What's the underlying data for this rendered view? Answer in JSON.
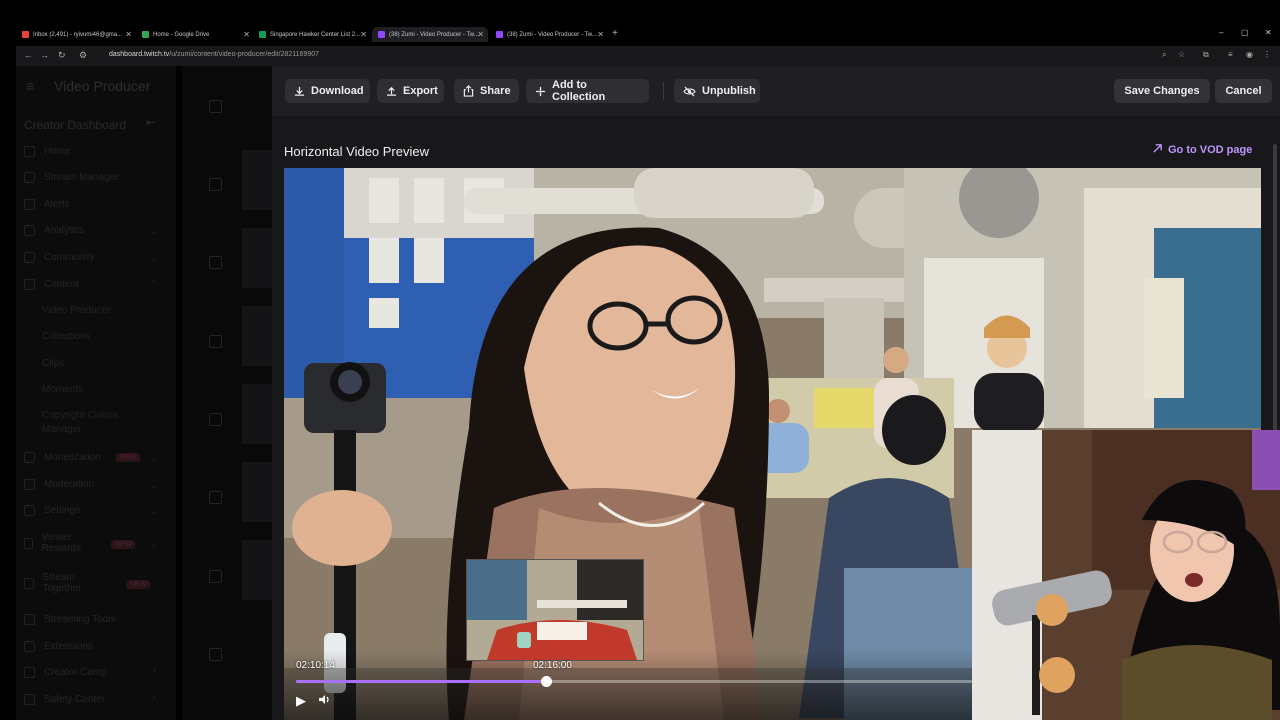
{
  "browser": {
    "tabs": [
      {
        "title": "Inbox (2,491) - ryivumi46@gma...",
        "favicon_color": "#ea4335"
      },
      {
        "title": "Home - Google Drive",
        "favicon_color": "#34a853"
      },
      {
        "title": "Singapore Hawker Center List 2...",
        "favicon_color": "#0f9d58"
      },
      {
        "title": "(38) Zumi - Video Producer - Tw...",
        "favicon_color": "#9146ff"
      },
      {
        "title": "(38) Zumi - Video Producer - Tw...",
        "favicon_color": "#9146ff"
      }
    ],
    "new_tab": "+",
    "window_controls": {
      "minimize": "–",
      "maximize": "▢",
      "close": "✕"
    },
    "url_domain": "dashboard.twitch.tv",
    "url_path": "/u/zumi/content/video-producer/edit/2821169907"
  },
  "sidebar": {
    "app_title": "Video Producer",
    "section_title": "Creator Dashboard",
    "items": [
      {
        "label": "Home"
      },
      {
        "label": "Stream Manager"
      },
      {
        "label": "Alerts"
      },
      {
        "label": "Analytics"
      },
      {
        "label": "Community"
      },
      {
        "label": "Content"
      },
      {
        "label": "Monetization",
        "badge": "NEW"
      },
      {
        "label": "Moderation"
      },
      {
        "label": "Settings"
      },
      {
        "label": "Viewer Rewards",
        "badge": "NEW"
      },
      {
        "label": "Stream Together",
        "badge": "NEW"
      },
      {
        "label": "Streaming Tools"
      },
      {
        "label": "Extensions"
      },
      {
        "label": "Creator Camp"
      },
      {
        "label": "Safety Center"
      }
    ],
    "content_sub": [
      "Video Producer",
      "Collections",
      "Clips",
      "Moments",
      "Copyright Claims Manager"
    ]
  },
  "toolbar": {
    "download": "Download",
    "export": "Export",
    "share": "Share",
    "add_to_collection": "Add to Collection",
    "unpublish": "Unpublish",
    "save_changes": "Save Changes",
    "cancel": "Cancel"
  },
  "preview": {
    "title": "Horizontal Video Preview",
    "vod_link": "Go to VOD page",
    "current_time": "02:10:14",
    "hover_time": "02:16:00",
    "progress_fraction": 0.37,
    "hover_fraction": 0.383
  },
  "colors": {
    "accent": "#a970ff",
    "link": "#bf94ff",
    "modal_bg": "#18181b",
    "toolbar_bg": "#1f1f23"
  },
  "icons": {
    "download": "download-icon",
    "export": "export-icon",
    "share": "share-icon",
    "add": "plus-icon",
    "unpublish": "eye-off-icon",
    "vod": "arrow-up-right-icon",
    "play": "play-icon",
    "volume": "volume-icon"
  }
}
